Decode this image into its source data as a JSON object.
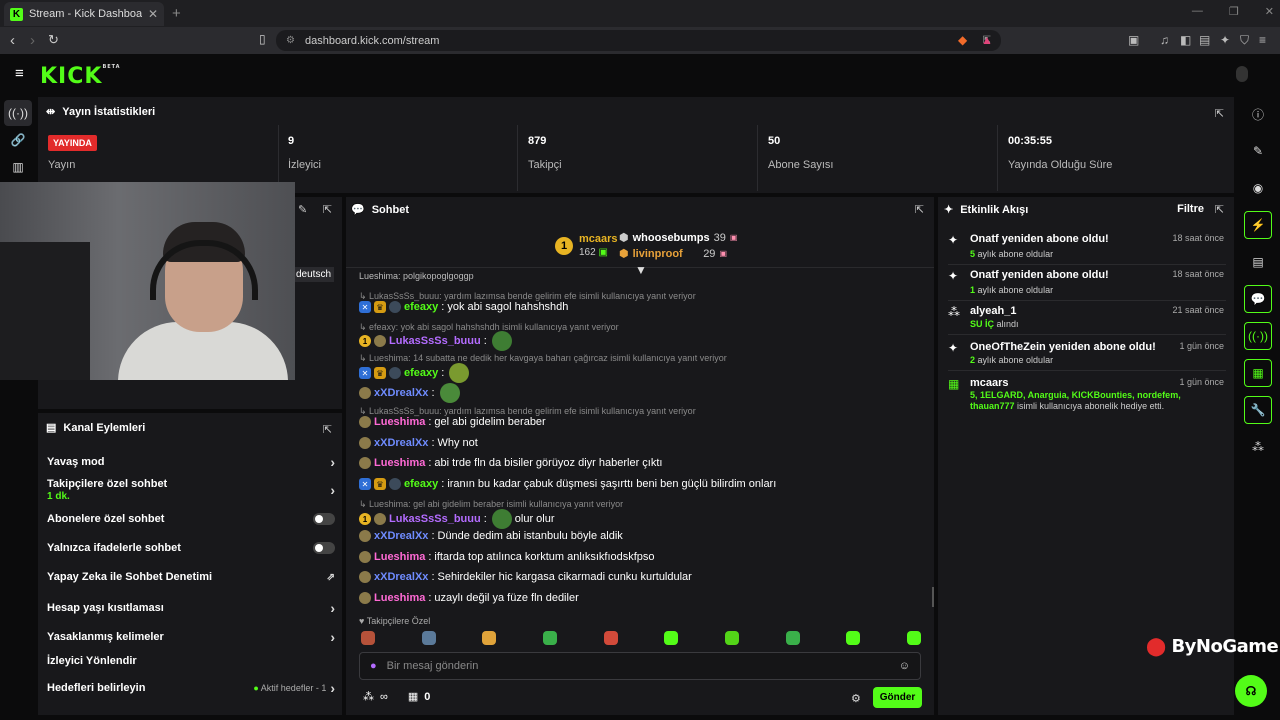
{
  "browser": {
    "tab_title": "Stream - Kick Dashboard",
    "url": "dashboard.kick.com/stream"
  },
  "brand": {
    "logo": "KICK",
    "beta": "BETA"
  },
  "stats": {
    "title": "Yayın İstatistikleri",
    "live_badge": "YAYINDA",
    "stream_label": "Yayın",
    "viewers_value": "9",
    "viewers_label": "İzleyici",
    "followers_value": "879",
    "followers_label": "Takipçi",
    "subs_value": "50",
    "subs_label": "Abone Sayısı",
    "uptime_value": "00:35:55",
    "uptime_label": "Yayında Olduğu Süre"
  },
  "overlay_tag": "deutsch",
  "channel_actions": {
    "title": "Kanal Eylemleri",
    "items": [
      {
        "label": "Yavaş mod",
        "control": "arrow"
      },
      {
        "label": "Takipçilere özel sohbet",
        "sub": "1 dk.",
        "control": "arrow"
      },
      {
        "label": "Abonelere özel sohbet",
        "control": "toggle"
      },
      {
        "label": "Yalnızca ifadelerle sohbet",
        "control": "toggle"
      },
      {
        "label": "Yapay Zeka ile Sohbet Denetimi",
        "control": "external"
      },
      {
        "label": "Hesap yaşı kısıtlaması",
        "control": "arrow"
      },
      {
        "label": "Yasaklanmış kelimeler",
        "control": "arrow"
      },
      {
        "label": "İzleyici Yönlendir",
        "control": "none"
      },
      {
        "label": "Hedefleri belirleyin",
        "control": "arrow",
        "extra": "Aktif hedefler - 1"
      }
    ]
  },
  "chat": {
    "title": "Sohbet",
    "top": [
      {
        "rank": "1",
        "name": "mcaars",
        "value": "162"
      },
      {
        "name": "whoosebumps",
        "value": "39"
      },
      {
        "name": "livinproof",
        "value": "29"
      }
    ],
    "clipped_line": "Lueshima: polgikopoglgoggp",
    "messages": [
      {
        "reply": "LukasSsSs_buuu: yardım lazımsa bende gelirim efe isimli kullanıcıya yanıt veriyor"
      },
      {
        "user": "efeaxy",
        "color": "green",
        "text": "yok abi sagol hahshshdh",
        "badges": [
          "blue",
          "gold",
          "shield"
        ]
      },
      {
        "reply": "efeaxy: yok abi sagol hahshshdh isimli kullanıcıya yanıt veriyor"
      },
      {
        "user": "LukasSsSs_buuu",
        "color": "purple",
        "text": "",
        "badges": [
          "one",
          "olive"
        ],
        "emote": true
      },
      {
        "reply": "Lueshima: 14 subatta ne dedik her kavgaya baharı çağırcaz isimli kullanıcıya yanıt veriyor"
      },
      {
        "user": "efeaxy",
        "color": "green",
        "text": "",
        "badges": [
          "blue",
          "gold",
          "shield"
        ],
        "emote": true
      },
      {
        "user": "xXDrealXx",
        "color": "blue",
        "text": "",
        "badges": [
          "olive"
        ],
        "emote": true
      },
      {
        "reply": "LukasSsSs_buuu: yardım lazımsa bende gelirim efe isimli kullanıcıya yanıt veriyor"
      },
      {
        "user": "Lueshima",
        "color": "pink",
        "text": "gel abi gidelim beraber",
        "badges": [
          "olive"
        ]
      },
      {
        "user": "xXDrealXx",
        "color": "blue",
        "text": "Why not",
        "badges": [
          "olive"
        ]
      },
      {
        "user": "Lueshima",
        "color": "pink",
        "text": "abi trde fln da bisiler görüyoz diyr haberler çıktı",
        "badges": [
          "olive"
        ]
      },
      {
        "user": "efeaxy",
        "color": "green",
        "text": "iranın bu kadar çabuk düşmesi şaşırttı beni ben güçlü bilirdim onları",
        "badges": [
          "blue",
          "gold",
          "shield"
        ]
      },
      {
        "reply": "Lueshima: gel abi gidelim beraber isimli kullanıcıya yanıt veriyor"
      },
      {
        "user": "LukasSsSs_buuu",
        "color": "purple",
        "text": "olur olur",
        "badges": [
          "one",
          "olive"
        ],
        "emote": true
      },
      {
        "user": "xXDrealXx",
        "color": "blue",
        "text": "Dünde dedim abi istanbulu böyle aldik",
        "badges": [
          "olive"
        ]
      },
      {
        "user": "Lueshima",
        "color": "pink",
        "text": "iftarda top atılınca korktum anlıksıkfıodskfpso",
        "badges": [
          "olive"
        ]
      },
      {
        "user": "xXDrealXx",
        "color": "blue",
        "text": "Sehirdekiler hic kargasa cikarmadi cunku kurtuldular",
        "badges": [
          "olive"
        ]
      },
      {
        "user": "Lueshima",
        "color": "pink",
        "text": "uzaylı değil ya füze fln dediler",
        "badges": [
          "olive"
        ]
      }
    ],
    "followers_only": "Takipçilere Özel",
    "input_placeholder": "Bir mesaj gönderin",
    "points": "∞",
    "store_count": "0",
    "send_label": "Gönder"
  },
  "activity": {
    "title": "Etkinlik Akışı",
    "filter": "Filtre",
    "events": [
      {
        "title": "Onatf yeniden abone oldu!",
        "time": "18 saat önce",
        "num": "5",
        "sub": " aylık abone oldular",
        "icon": "sparkle-icon"
      },
      {
        "title": "Onatf yeniden abone oldu!",
        "time": "18 saat önce",
        "num": "1",
        "sub": " aylık abone oldular",
        "icon": "sparkle-icon"
      },
      {
        "title": "alyeah_1",
        "time": "21 saat önce",
        "num": "SU İÇ",
        "sub": " alındı",
        "icon": "kick-points-icon"
      },
      {
        "title": "OneOfTheZein yeniden abone oldu!",
        "time": "1 gün önce",
        "num": "2",
        "sub": " aylık abone oldular",
        "icon": "sparkle-icon"
      },
      {
        "title": "mcaars",
        "time": "1 gün önce",
        "num": "5, 1ELGARD, Anarguia, KICKBounties, nordefem, thauan777",
        "sub": " isimli kullanıcıya abonelik hediye etti.",
        "icon": "gift-icon"
      }
    ]
  },
  "watermark": "ByNoGame",
  "colors": {
    "accent": "#53fc18",
    "panel": "#18181b",
    "live": "#e22b2b"
  }
}
